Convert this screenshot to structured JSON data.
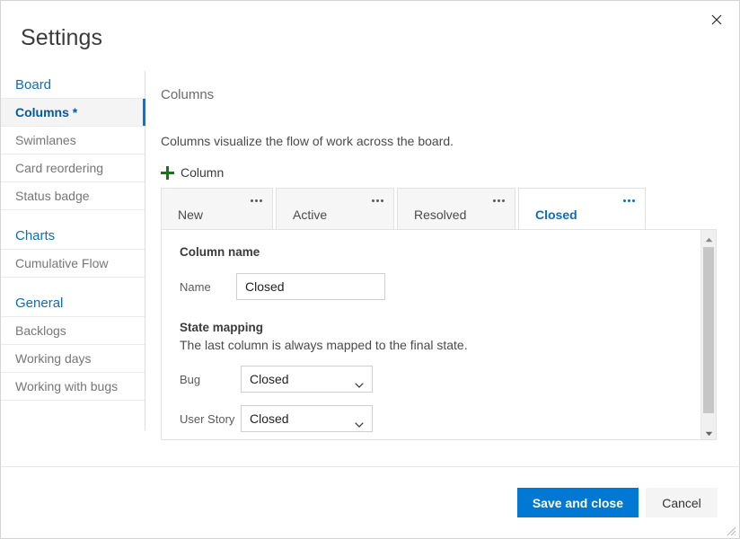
{
  "dialog": {
    "title": "Settings",
    "close_icon": "close-icon"
  },
  "sidebar": {
    "groups": [
      {
        "header": "Board",
        "items": [
          {
            "label": "Columns *",
            "selected": true
          },
          {
            "label": "Swimlanes",
            "selected": false
          },
          {
            "label": "Card reordering",
            "selected": false
          },
          {
            "label": "Status badge",
            "selected": false
          }
        ]
      },
      {
        "header": "Charts",
        "items": [
          {
            "label": "Cumulative Flow",
            "selected": false
          }
        ]
      },
      {
        "header": "General",
        "items": [
          {
            "label": "Backlogs",
            "selected": false
          },
          {
            "label": "Working days",
            "selected": false
          },
          {
            "label": "Working with bugs",
            "selected": false
          }
        ]
      }
    ]
  },
  "main": {
    "heading": "Columns",
    "description": "Columns visualize the flow of work across the board.",
    "add_column_label": "Column",
    "add_column_icon": "plus-icon"
  },
  "tabs": [
    {
      "label": "New",
      "active": false,
      "width": 125
    },
    {
      "label": "Active",
      "active": false,
      "width": 132
    },
    {
      "label": "Resolved",
      "active": false,
      "width": 132
    },
    {
      "label": "Closed",
      "active": true,
      "width": 142
    }
  ],
  "panel": {
    "column_name": {
      "section_title": "Column name",
      "name_label": "Name",
      "name_value": "Closed",
      "name_placeholder": "Column name"
    },
    "state_mapping": {
      "section_title": "State mapping",
      "section_sub": "The last column is always mapped to the final state.",
      "rows": [
        {
          "label": "Bug",
          "value": "Closed"
        },
        {
          "label": "User Story",
          "value": "Closed"
        }
      ]
    },
    "scrollbar": {
      "up_icon": "scroll-up-arrow-icon",
      "down_icon": "scroll-down-arrow-icon"
    }
  },
  "footer": {
    "save_label": "Save and close",
    "cancel_label": "Cancel"
  },
  "colors": {
    "accent": "#0078d4",
    "link": "#0a6ebd",
    "selected_text": "#005a9e",
    "add_icon_green": "#107c10",
    "panel_border": "#e2e2e2",
    "tab_inactive_bg": "#f6f6f6",
    "selected_nav_bg": "#f4f4f4"
  }
}
